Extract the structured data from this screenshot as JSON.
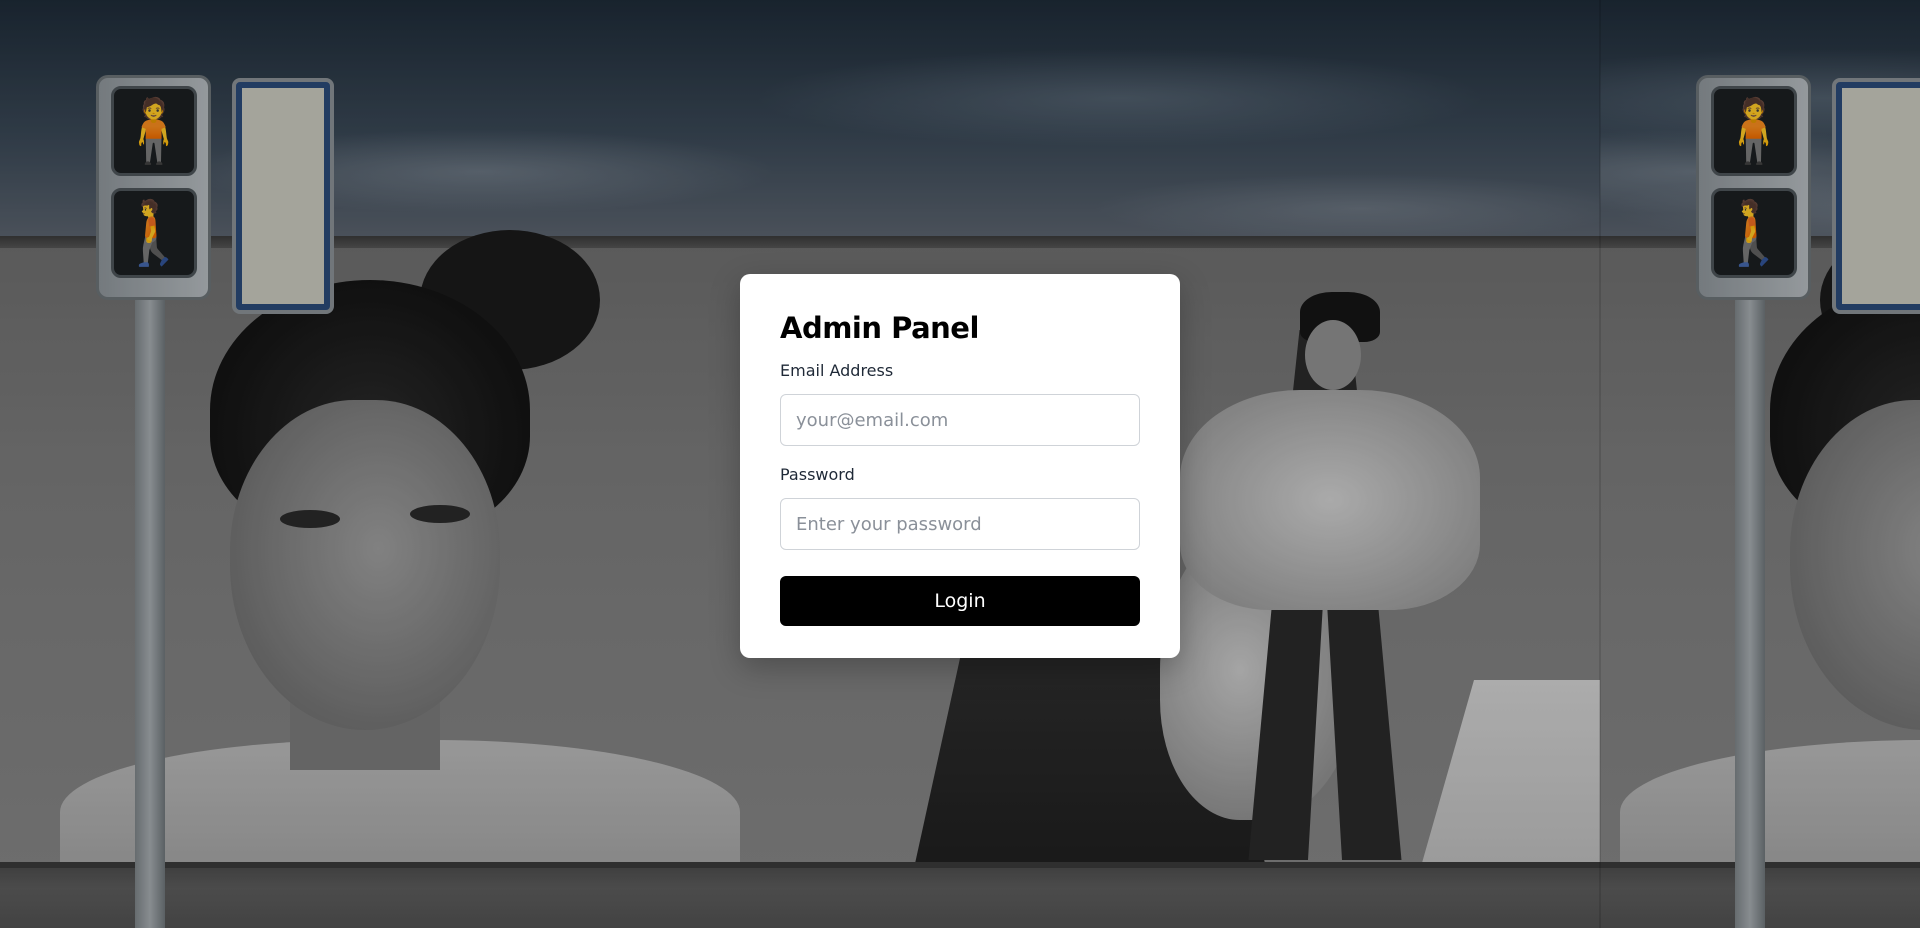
{
  "login_form": {
    "title": "Admin Panel",
    "email_label": "Email Address",
    "email_value": "",
    "email_placeholder": "your@email.com",
    "password_label": "Password",
    "password_value": "",
    "password_placeholder": "Enter your password",
    "submit_label": "Login"
  },
  "theme": {
    "card_background": "#ffffff",
    "button_background": "#000000",
    "button_text": "#ffffff"
  }
}
